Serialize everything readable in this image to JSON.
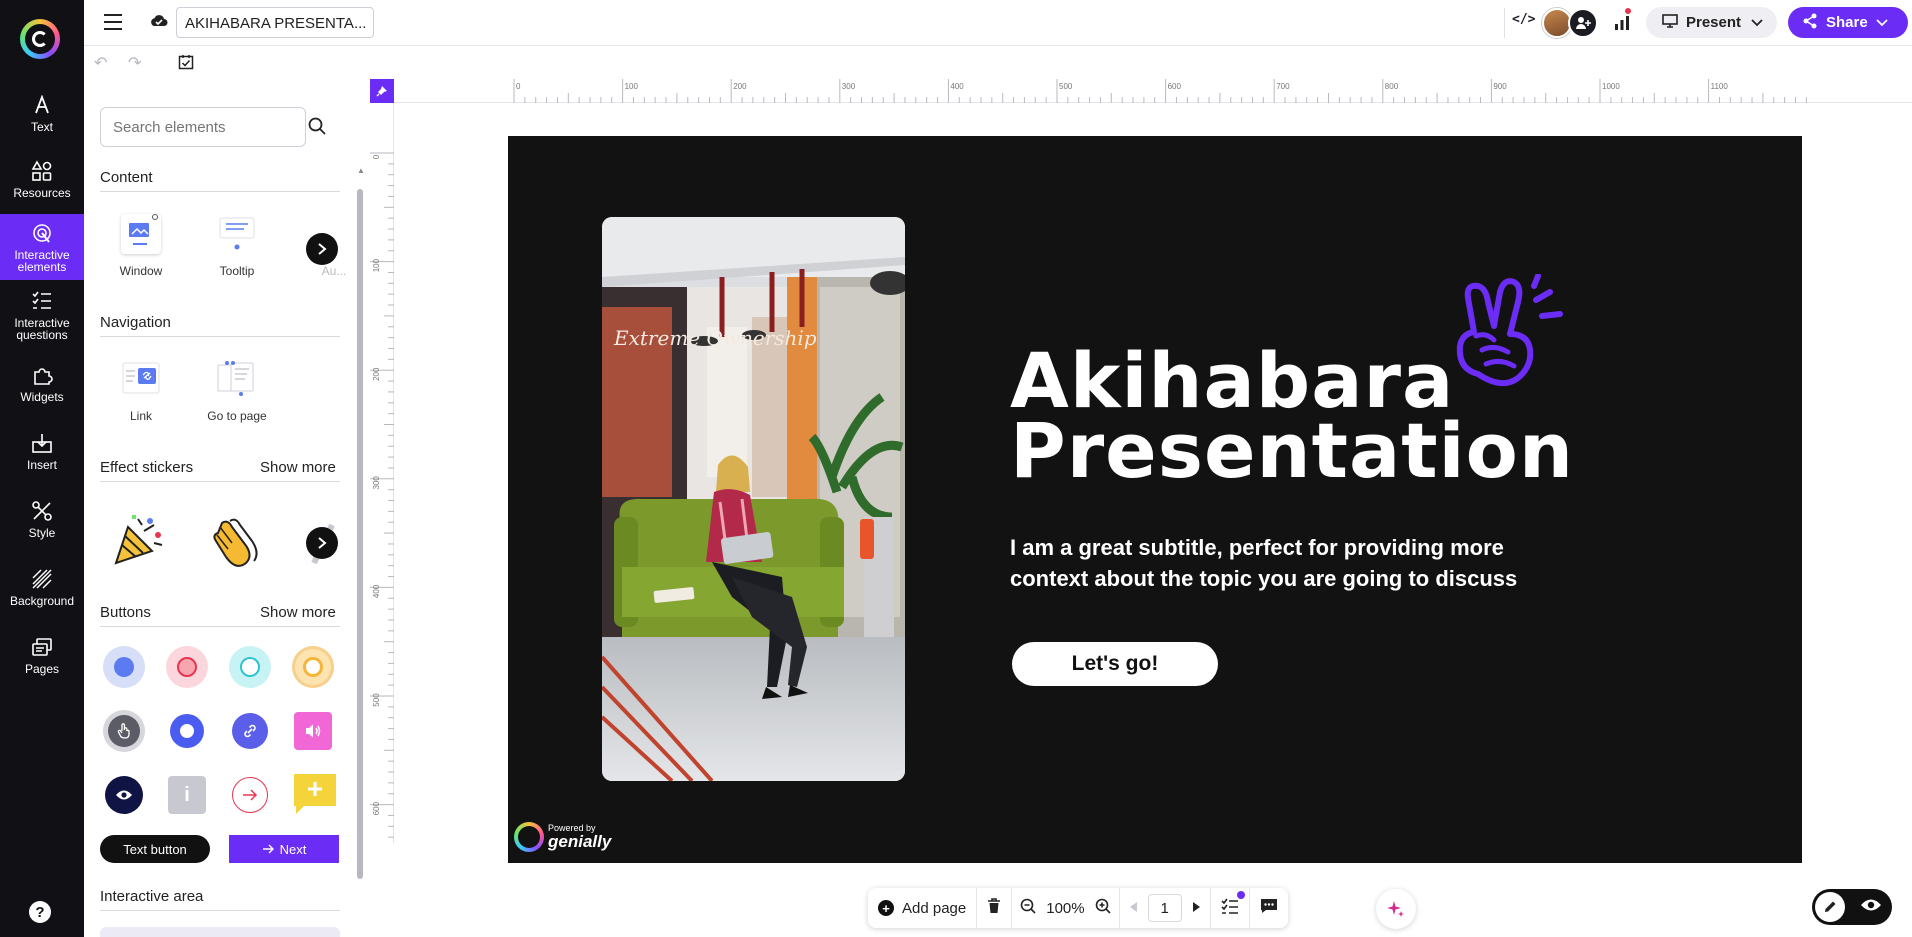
{
  "app": {
    "rail": [
      {
        "label": "Text",
        "icon": "text-icon"
      },
      {
        "label": "Resources",
        "icon": "resources-icon"
      },
      {
        "label": "Interactive elements",
        "icon": "interactive-elements-icon",
        "active": true
      },
      {
        "label": "Interactive questions",
        "icon": "interactive-questions-icon"
      },
      {
        "label": "Widgets",
        "icon": "widgets-icon"
      },
      {
        "label": "Insert",
        "icon": "insert-icon"
      },
      {
        "label": "Style",
        "icon": "style-icon"
      },
      {
        "label": "Background",
        "icon": "background-icon"
      },
      {
        "label": "Pages",
        "icon": "pages-icon"
      }
    ],
    "help": "?",
    "accent": "#6b2cf5"
  },
  "topbar": {
    "doc_title": "AKIHABARA PRESENTA...",
    "present_label": "Present",
    "share_label": "Share"
  },
  "panel": {
    "search_placeholder": "Search elements",
    "content": {
      "title": "Content",
      "items": [
        "Window",
        "Tooltip",
        "Au..."
      ]
    },
    "navigation": {
      "title": "Navigation",
      "items": [
        "Link",
        "Go to page"
      ]
    },
    "effect_stickers": {
      "title": "Effect stickers",
      "show_more": "Show more"
    },
    "buttons": {
      "title": "Buttons",
      "show_more": "Show more",
      "text_button": "Text button",
      "next_button": "Next",
      "info_glyph": "i",
      "plus_glyph": "+"
    },
    "interactive_area": {
      "title": "Interactive area"
    }
  },
  "rulers": {
    "top": [
      "0",
      "100",
      "200",
      "300",
      "400",
      "500",
      "600",
      "700",
      "800",
      "900",
      "1000",
      "1100"
    ],
    "left": [
      "0",
      "100",
      "200",
      "300",
      "400",
      "500",
      "600"
    ]
  },
  "slide": {
    "headline_line1": "Akihabara",
    "headline_line2": "Presentation",
    "subtitle": "I am a great subtitle, perfect for providing more context about the topic you are going to discuss",
    "cta": "Let's go!",
    "photo_wall_text": "Extreme Ownership",
    "brand_small": "Powered by",
    "brand_name": "genially",
    "background": "#121212",
    "doodle_color": "#6b2cf5"
  },
  "bottom_toolbar": {
    "add_page": "Add page",
    "zoom": "100%",
    "page": "1"
  }
}
